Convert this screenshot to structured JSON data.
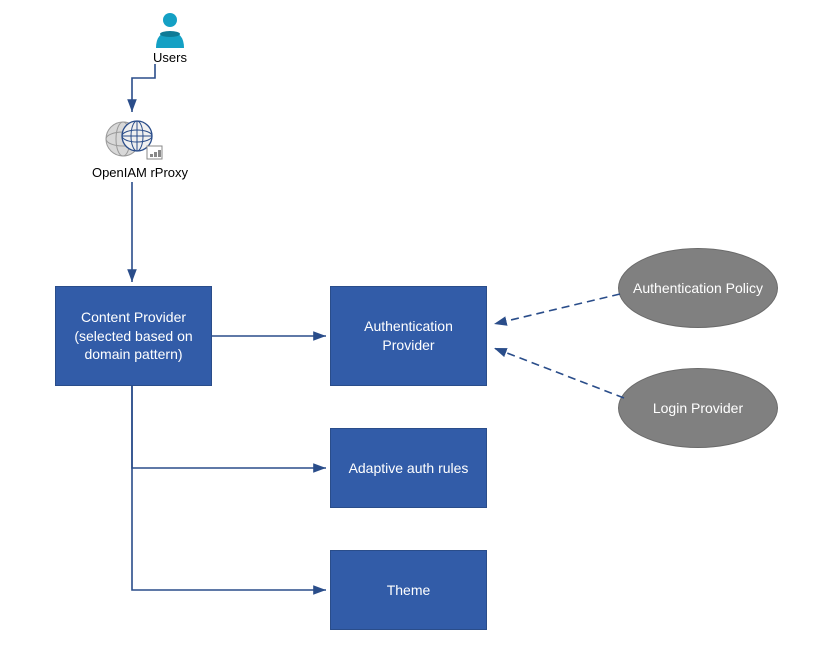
{
  "icons": {
    "users_label": "Users",
    "rproxy_label": "OpenIAM rProxy"
  },
  "boxes": {
    "content_provider": "Content Provider (selected based on domain pattern)",
    "auth_provider": "Authentication Provider",
    "adaptive_rules": "Adaptive auth rules",
    "theme": "Theme"
  },
  "ellipses": {
    "auth_policy": "Authentication Policy",
    "login_provider": "Login Provider"
  },
  "colors": {
    "box": "#325ca8",
    "ellipse": "#808080",
    "arrow": "#2a4d8a"
  }
}
